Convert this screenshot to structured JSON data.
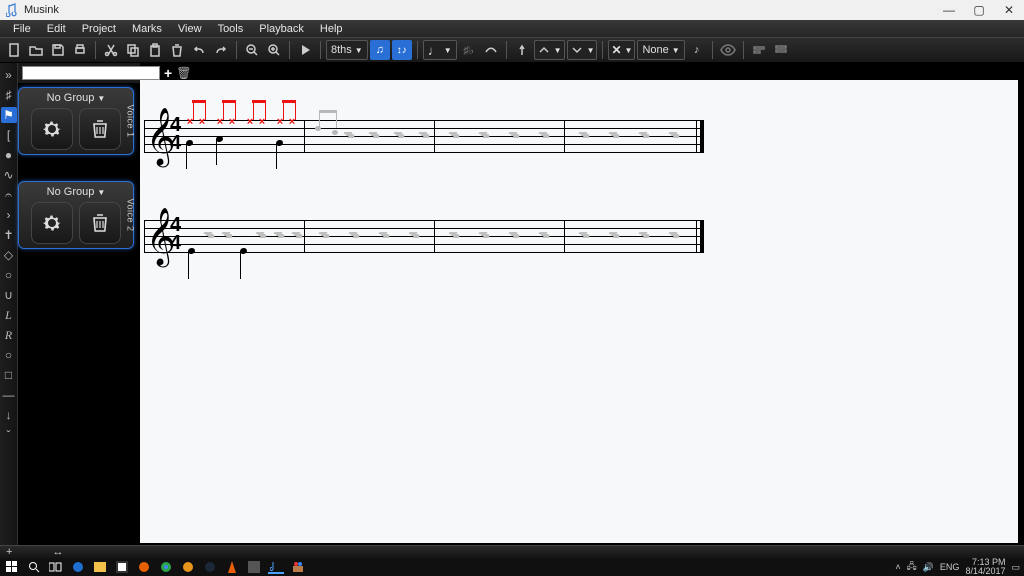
{
  "title": "Musink",
  "menus": [
    "File",
    "Edit",
    "Project",
    "Marks",
    "View",
    "Tools",
    "Playback",
    "Help"
  ],
  "toolbar": {
    "beaming_label": "8ths",
    "articulation_label": "None"
  },
  "voice_panels": [
    {
      "group_label": "No Group",
      "voice_label": "Voice 1"
    },
    {
      "group_label": "No Group",
      "voice_label": "Voice 2"
    }
  ],
  "score": {
    "clef_glyph": "𝄞",
    "time_top": "4",
    "time_bottom": "4"
  },
  "tray": {
    "lang": "ENG",
    "time": "7:13 PM",
    "date": "8/14/2017"
  }
}
